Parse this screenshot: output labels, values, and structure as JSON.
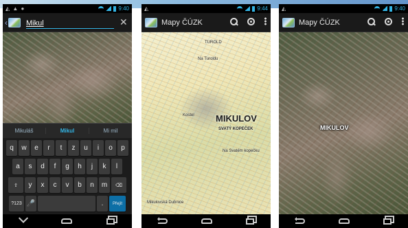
{
  "screens": [
    {
      "status": {
        "left": "◭ ▲ ●",
        "time": "9:40"
      },
      "search": {
        "value": "Mikul"
      },
      "suggestions": [
        "Mikuláš",
        "Mikul",
        "Mi mil"
      ],
      "keyboard": {
        "row1": [
          "q",
          "w",
          "e",
          "r",
          "t",
          "z",
          "u",
          "i",
          "o",
          "p"
        ],
        "row2": [
          "a",
          "s",
          "d",
          "f",
          "g",
          "h",
          "j",
          "k",
          "l"
        ],
        "row3": [
          "⇧",
          "y",
          "x",
          "c",
          "v",
          "b",
          "n",
          "m",
          "⌫"
        ],
        "row4": [
          "?123",
          "🎤",
          "",
          ".",
          "Přejít"
        ]
      }
    },
    {
      "status": {
        "left": "◭",
        "time": "9:44"
      },
      "title": "Mapy ČÚZK",
      "map_labels": {
        "big": "MIKULOV",
        "hill": "SVATÝ KOPEČEK",
        "turold": "Na Turoldu",
        "turold2": "TUROLD",
        "kostel": "Kostel",
        "sv_jan": "Na Svatém kopečku",
        "mikulovska": "Mikulovská Dubnice"
      }
    },
    {
      "status": {
        "left": "◭",
        "time": "9:40"
      },
      "title": "Mapy ČÚZK",
      "map_labels": {
        "big": "MIKULOV"
      }
    }
  ],
  "icons": {
    "app": "app-map-icon",
    "search": "search-icon",
    "location": "my-location-icon",
    "overflow": "overflow-menu-icon",
    "close": "close-icon",
    "back": "back-arrow-icon"
  },
  "colors": {
    "accent": "#33b5e5",
    "actionbar": "#1a1a1a"
  }
}
